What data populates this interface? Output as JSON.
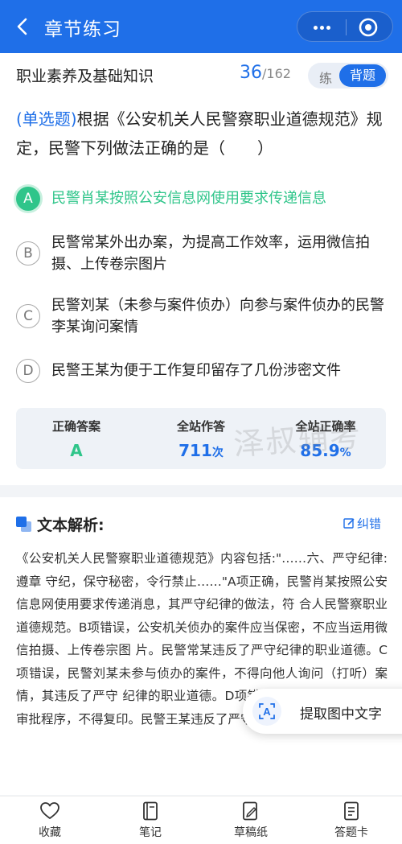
{
  "topbar": {
    "title": "章节练习",
    "back_icon": "chevron-left-icon",
    "more_icon": "more-dots-icon",
    "target_icon": "target-icon"
  },
  "subject": {
    "title": "职业素养及基础知识",
    "current": "36",
    "total": "/162",
    "mode_practice": "练",
    "mode_recite": "背题"
  },
  "question": {
    "type_label": "(单选题)",
    "text": "根据《公安机关人民警察职业道德规范》规定，民警下列做法正确的是（　　）",
    "options": [
      {
        "letter": "A",
        "text": "民警肖某按照公安信息网使用要求传递信息",
        "correct": true
      },
      {
        "letter": "B",
        "text": "民警常某外出办案，为提高工作效率，运用微信拍摄、上传卷宗图片",
        "correct": false
      },
      {
        "letter": "C",
        "text": "民警刘某（未参与案件侦办）向参与案件侦办的民警李某询问案情",
        "correct": false
      },
      {
        "letter": "D",
        "text": "民警王某为便于工作复印留存了几份涉密文件",
        "correct": false
      }
    ]
  },
  "stats": {
    "answer_label": "正确答案",
    "answer_value": "A",
    "attempts_label": "全站作答",
    "attempts_value": "711",
    "attempts_unit": "次",
    "accuracy_label": "全站正确率",
    "accuracy_value": "85.9",
    "accuracy_unit": "%"
  },
  "watermark": "泽叔辅考",
  "analysis": {
    "title": "文本解析:",
    "fix_label": "纠错",
    "text": "《公安机关人民警察职业道德规范》内容包括:\"……六、严守纪律:遵章 守纪，保守秘密，令行禁止……\"A项正确，民警肖某按照公安信息网使用要求传递消息，其严守纪律的做法，符 合人民警察职业道德规范。B项错误，公安机关侦办的案件应当保密，不应当运用微信拍摄、上传卷宗图 片。民警常某违反了严守纪律的职业道德。C项错误，民警刘某未参与侦办的案件，不得向他人询问（打听）案情，其违反了严守 纪律的职业道德。D项错误，涉密文件未经法定审批程序，不得复印。民警王某违反了严守纪律的 职业道德。"
  },
  "ocr": {
    "label": "提取图中文字"
  },
  "bottom_nav": [
    {
      "label": "收藏",
      "icon": "heart-icon"
    },
    {
      "label": "笔记",
      "icon": "notebook-icon"
    },
    {
      "label": "草稿纸",
      "icon": "draft-pen-icon"
    },
    {
      "label": "答题卡",
      "icon": "answer-card-icon"
    }
  ],
  "colors": {
    "primary": "#1f6fe8",
    "correct": "#2fc58a"
  }
}
